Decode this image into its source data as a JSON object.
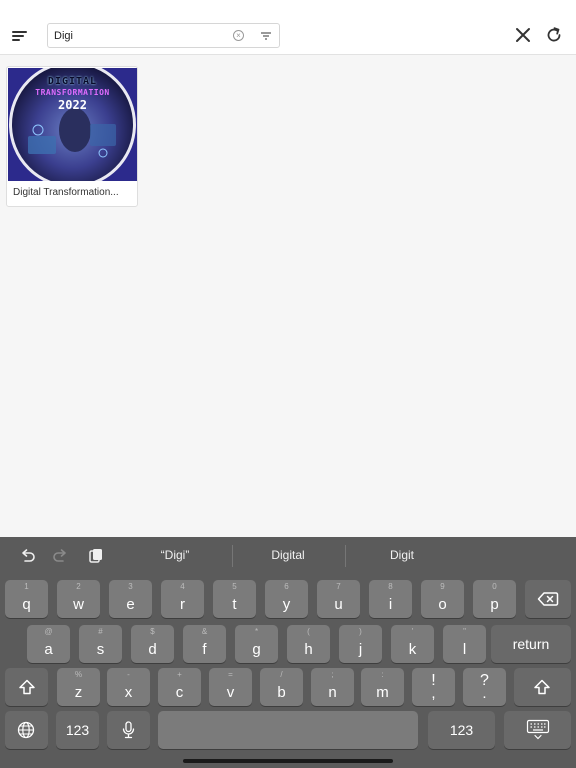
{
  "search": {
    "value": "Digi",
    "placeholder": ""
  },
  "results": [
    {
      "title": "Digital Transformation...",
      "thumb_text": [
        "DIGITAL",
        "TRANSFORMATION",
        "2022"
      ]
    }
  ],
  "keyboard": {
    "suggestions": [
      "“Digi”",
      "Digital",
      "Digit"
    ],
    "row1": [
      {
        "ch": "q",
        "hint": "1"
      },
      {
        "ch": "w",
        "hint": "2"
      },
      {
        "ch": "e",
        "hint": "3"
      },
      {
        "ch": "r",
        "hint": "4"
      },
      {
        "ch": "t",
        "hint": "5"
      },
      {
        "ch": "y",
        "hint": "6"
      },
      {
        "ch": "u",
        "hint": "7"
      },
      {
        "ch": "i",
        "hint": "8"
      },
      {
        "ch": "o",
        "hint": "9"
      },
      {
        "ch": "p",
        "hint": "0"
      }
    ],
    "row2": [
      {
        "ch": "a",
        "hint": "@"
      },
      {
        "ch": "s",
        "hint": "#"
      },
      {
        "ch": "d",
        "hint": "$"
      },
      {
        "ch": "f",
        "hint": "&"
      },
      {
        "ch": "g",
        "hint": "*"
      },
      {
        "ch": "h",
        "hint": "("
      },
      {
        "ch": "j",
        "hint": ")"
      },
      {
        "ch": "k",
        "hint": "'"
      },
      {
        "ch": "l",
        "hint": "\""
      }
    ],
    "row3": [
      {
        "ch": "z",
        "hint": "%"
      },
      {
        "ch": "x",
        "hint": "-"
      },
      {
        "ch": "c",
        "hint": "+"
      },
      {
        "ch": "v",
        "hint": "="
      },
      {
        "ch": "b",
        "hint": "/"
      },
      {
        "ch": "n",
        "hint": ";"
      },
      {
        "ch": "m",
        "hint": ":"
      },
      {
        "ch": ",",
        "hint": "!"
      },
      {
        "ch": ".",
        "hint": "?"
      }
    ],
    "return_label": "return",
    "numbers_label": "123",
    "icons": {
      "shift": "shift-icon",
      "delete": "delete-icon",
      "globe": "globe-icon",
      "mic": "microphone-icon",
      "dismiss": "keyboard-dismiss-icon",
      "undo": "undo-icon",
      "redo": "redo-icon",
      "paste": "paste-icon"
    }
  }
}
